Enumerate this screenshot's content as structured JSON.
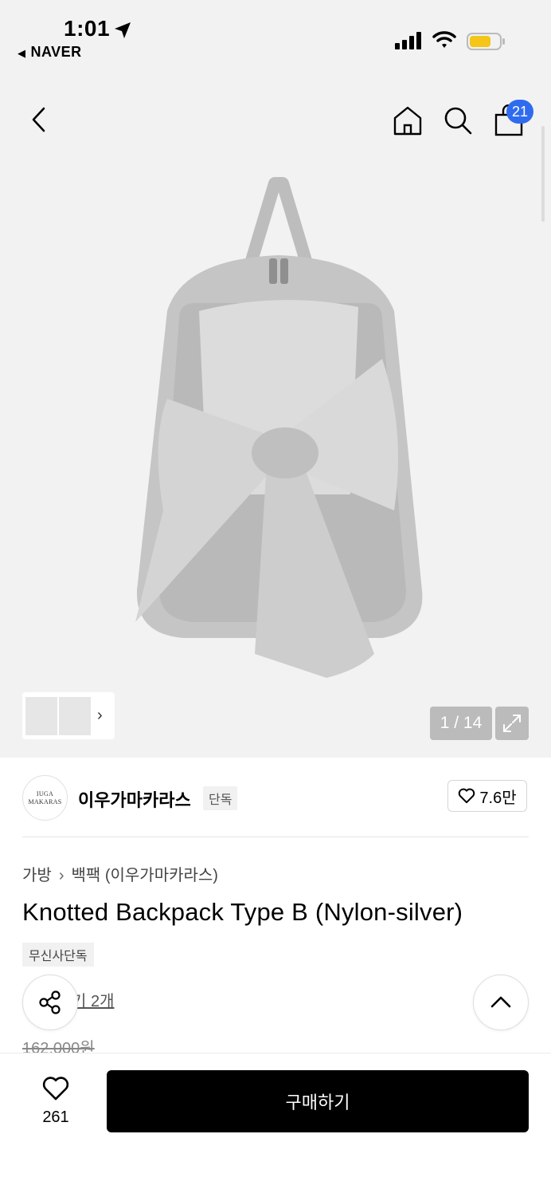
{
  "status_bar": {
    "time": "1:01",
    "back_app": "NAVER"
  },
  "nav": {
    "cart_count": "21"
  },
  "gallery": {
    "counter": "1 / 14"
  },
  "brand": {
    "logo_line1": "IUGA",
    "logo_line2": "MAKARAS",
    "name": "이우가마카라스",
    "tag": "단독",
    "likes": "7.6만"
  },
  "product": {
    "breadcrumb": [
      "가방",
      "백팩 (이우가마카라스)"
    ],
    "title": "Knotted Backpack Type B (Nylon-silver)",
    "exclusive_badge": "무신사단독",
    "review_text": "기 2개",
    "original_price": "162,000원"
  },
  "bottom": {
    "wish_count": "261",
    "buy_label": "구매하기"
  },
  "colors": {
    "badge_blue": "#2f6bef",
    "battery_yellow": "#f5c518",
    "buy_black": "#000000"
  }
}
